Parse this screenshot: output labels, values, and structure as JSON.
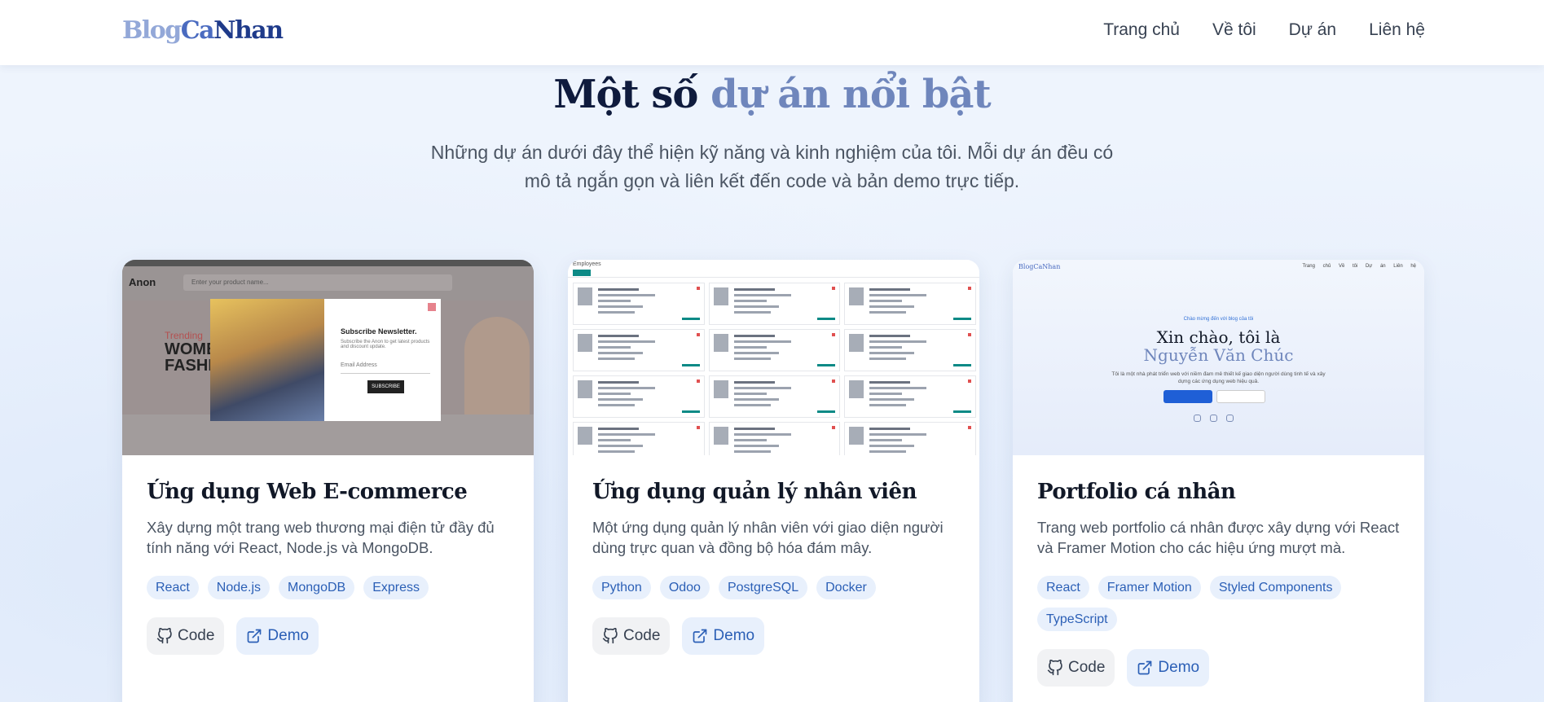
{
  "header": {
    "logo_part1": "Blog",
    "logo_part2": "Ca",
    "logo_part3": "Nhan",
    "nav": [
      "Trang chủ",
      "Về tôi",
      "Dự án",
      "Liên hệ"
    ]
  },
  "section": {
    "title_main": "Một số ",
    "title_accent": "dự án nổi bật",
    "subtitle": "Những dự án dưới đây thể hiện kỹ năng và kinh nghiệm của tôi. Mỗi dự án đều có mô tả ngắn gọn và liên kết đến code và bản demo trực tiếp."
  },
  "projects": [
    {
      "title": "Ứng dụng Web E-commerce",
      "description": "Xây dựng một trang web thương mại điện tử đầy đủ tính năng với React, Node.js và MongoDB.",
      "tags": [
        "React",
        "Node.js",
        "MongoDB",
        "Express"
      ],
      "code_label": "Code",
      "demo_label": "Demo",
      "thumb": {
        "brand": "Anon",
        "search_placeholder": "Enter your product name...",
        "trending": "Trending",
        "hero": "WOMEN FASHION",
        "popup_title": "Subscribe Newsletter.",
        "popup_text": "Subscribe the Anon to get latest products and discount update.",
        "popup_input": "Email Address",
        "popup_button": "SUBSCRIBE"
      }
    },
    {
      "title": "Ứng dụng quản lý nhân viên",
      "description": "Một ứng dụng quản lý nhân viên với giao diện người dùng trực quan và đồng bộ hóa đám mây.",
      "tags": [
        "Python",
        "Odoo",
        "PostgreSQL",
        "Docker"
      ],
      "code_label": "Code",
      "demo_label": "Demo",
      "thumb": {
        "header": "Employees"
      }
    },
    {
      "title": "Portfolio cá nhân",
      "description": "Trang web portfolio cá nhân được xây dựng với React và Framer Motion cho các hiệu ứng mượt mà.",
      "tags": [
        "React",
        "Framer Motion",
        "Styled Components",
        "TypeScript"
      ],
      "code_label": "Code",
      "demo_label": "Demo",
      "thumb": {
        "logo": "BlogCaNhan",
        "nav": "Trang chủ Về tôi Dự án Liên hệ",
        "greeting": "Chào mừng đến với blog của tôi",
        "heading1": "Xin chào, tôi là",
        "heading2": "Nguyễn Văn Chúc",
        "desc": "Tôi là một nhà phát triển web với niềm đam mê thiết kế giao diện người dùng tinh tế và xây dựng các ứng dụng web hiệu quả."
      }
    }
  ],
  "colors": {
    "accent": "#2b5fb6",
    "title_accent": "#6f86bc",
    "background": "#eef4fd"
  }
}
